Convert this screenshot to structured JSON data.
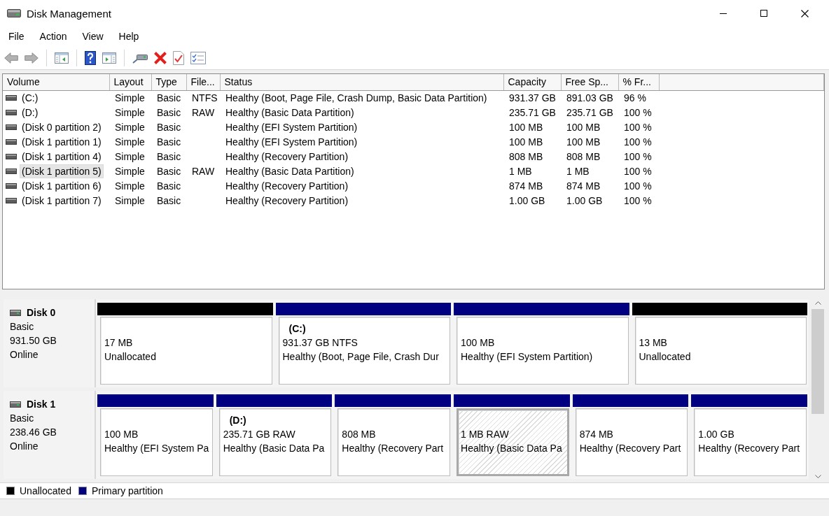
{
  "window": {
    "title": "Disk Management"
  },
  "menu": [
    {
      "label": "File"
    },
    {
      "label": "Action"
    },
    {
      "label": "View"
    },
    {
      "label": "Help"
    }
  ],
  "volume_list": {
    "columns": [
      "Volume",
      "Layout",
      "Type",
      "File...",
      "Status",
      "Capacity",
      "Free Sp...",
      "% Fr..."
    ],
    "rows": [
      {
        "volume": "(C:)",
        "layout": "Simple",
        "type": "Basic",
        "file_system": "NTFS",
        "status": "Healthy (Boot, Page File, Crash Dump, Basic Data Partition)",
        "capacity": "931.37 GB",
        "free_space": "891.03 GB",
        "percent_free": "96 %",
        "selected": false
      },
      {
        "volume": "(D:)",
        "layout": "Simple",
        "type": "Basic",
        "file_system": "RAW",
        "status": "Healthy (Basic Data Partition)",
        "capacity": "235.71 GB",
        "free_space": "235.71 GB",
        "percent_free": "100 %",
        "selected": false
      },
      {
        "volume": "(Disk 0 partition 2)",
        "layout": "Simple",
        "type": "Basic",
        "status": "Healthy (EFI System Partition)",
        "capacity": "100 MB",
        "free_space": "100 MB",
        "percent_free": "100 %",
        "selected": false
      },
      {
        "volume": "(Disk 1 partition 1)",
        "layout": "Simple",
        "type": "Basic",
        "status": "Healthy (EFI System Partition)",
        "capacity": "100 MB",
        "free_space": "100 MB",
        "percent_free": "100 %",
        "selected": false
      },
      {
        "volume": "(Disk 1 partition 4)",
        "layout": "Simple",
        "type": "Basic",
        "status": "Healthy (Recovery Partition)",
        "capacity": "808 MB",
        "free_space": "808 MB",
        "percent_free": "100 %",
        "selected": false
      },
      {
        "volume": "(Disk 1 partition 5)",
        "layout": "Simple",
        "type": "Basic",
        "file_system": "RAW",
        "status": "Healthy (Basic Data Partition)",
        "capacity": "1 MB",
        "free_space": "1 MB",
        "percent_free": "100 %",
        "selected": true
      },
      {
        "volume": "(Disk 1 partition 6)",
        "layout": "Simple",
        "type": "Basic",
        "status": "Healthy (Recovery Partition)",
        "capacity": "874 MB",
        "free_space": "874 MB",
        "percent_free": "100 %",
        "selected": false
      },
      {
        "volume": "(Disk 1 partition 7)",
        "layout": "Simple",
        "type": "Basic",
        "status": "Healthy (Recovery Partition)",
        "capacity": "1.00 GB",
        "free_space": "1.00 GB",
        "percent_free": "100 %",
        "selected": false
      }
    ]
  },
  "disks": [
    {
      "name": "Disk 0",
      "type": "Basic",
      "size": "931.50 GB",
      "status": "Online",
      "partitions": [
        {
          "color": "#000000",
          "size": "17 MB",
          "status": "Unallocated",
          "selected": false
        },
        {
          "color": "#000080",
          "name": "(C:)",
          "size": "931.37 GB NTFS",
          "status": "Healthy (Boot, Page File, Crash Dur",
          "selected": false
        },
        {
          "color": "#000080",
          "size": "100 MB",
          "status": "Healthy (EFI System Partition)",
          "selected": false
        },
        {
          "color": "#000000",
          "size": "13 MB",
          "status": "Unallocated",
          "selected": false
        }
      ]
    },
    {
      "name": "Disk 1",
      "type": "Basic",
      "size": "238.46 GB",
      "status": "Online",
      "partitions": [
        {
          "color": "#000080",
          "size": "100 MB",
          "status": "Healthy (EFI System Pa",
          "selected": false
        },
        {
          "color": "#000080",
          "name": "(D:)",
          "size": "235.71 GB RAW",
          "status": "Healthy (Basic Data Pa",
          "selected": false
        },
        {
          "color": "#000080",
          "size": "808 MB",
          "status": "Healthy (Recovery Part",
          "selected": false
        },
        {
          "color": "#000080",
          "size": "1 MB RAW",
          "status": "Healthy (Basic Data Pa",
          "selected": true
        },
        {
          "color": "#000080",
          "size": "874 MB",
          "status": "Healthy (Recovery Part",
          "selected": false
        },
        {
          "color": "#000080",
          "size": "1.00 GB",
          "status": "Healthy (Recovery Part",
          "selected": false
        }
      ]
    }
  ],
  "legend": [
    {
      "label": "Unallocated",
      "color": "#000000"
    },
    {
      "label": "Primary partition",
      "color": "#000080"
    }
  ]
}
